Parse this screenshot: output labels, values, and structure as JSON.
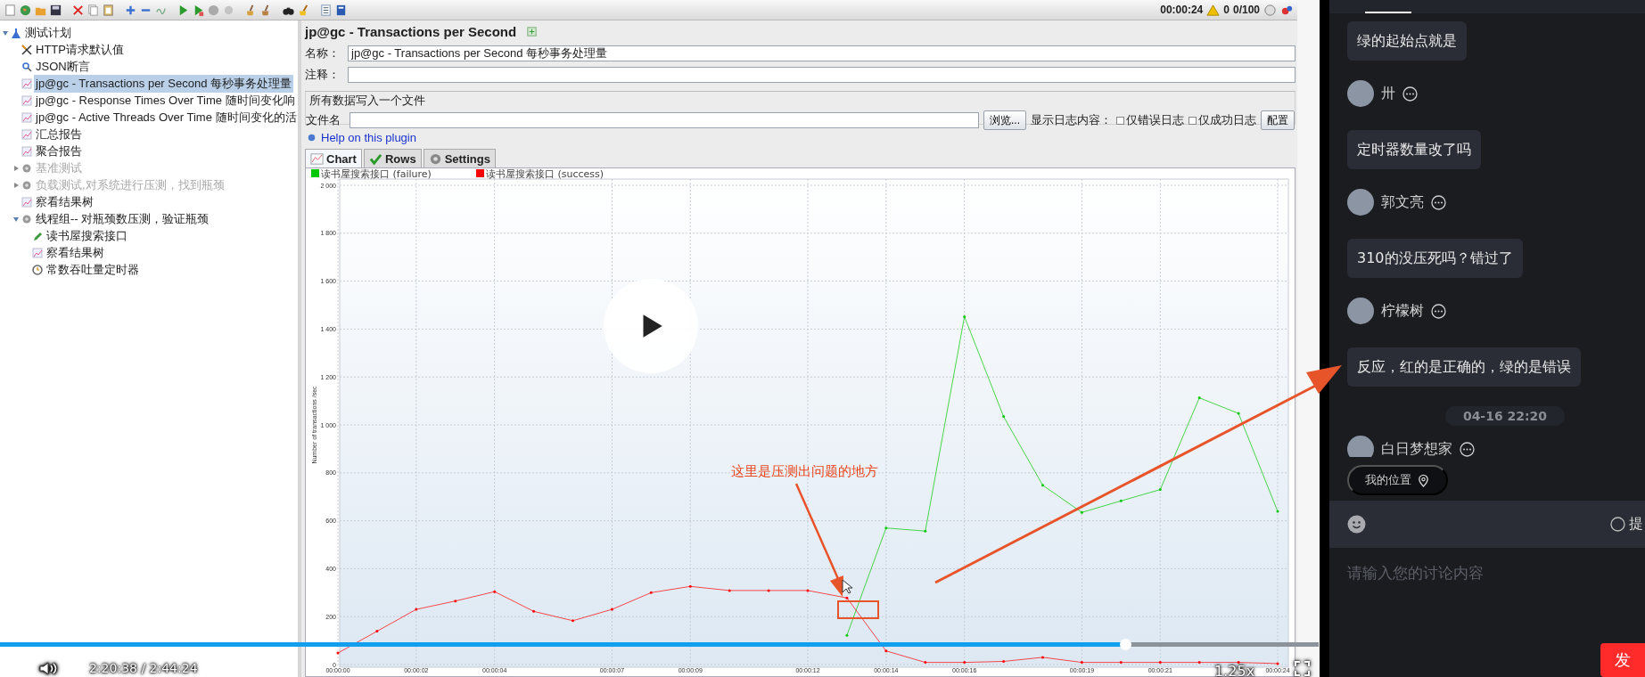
{
  "toolbar": {
    "elapsed": "00:00:24",
    "warnings": "0",
    "threads": "0/100"
  },
  "tree": {
    "label": "测试计划",
    "kind": "plan",
    "expanded": true,
    "selected": false,
    "disabled": false,
    "children": [
      {
        "label": "HTTP请求默认值",
        "kind": "config",
        "selected": false,
        "disabled": false
      },
      {
        "label": "JSON断言",
        "kind": "assertion",
        "selected": false,
        "disabled": false
      },
      {
        "label": "jp@gc - Transactions per Second 每秒事务处理量",
        "kind": "listener",
        "selected": true,
        "disabled": false
      },
      {
        "label": "jp@gc - Response Times Over Time 随时间变化响",
        "kind": "listener",
        "selected": false,
        "disabled": false
      },
      {
        "label": "jp@gc - Active Threads Over Time 随时间变化的活",
        "kind": "listener",
        "selected": false,
        "disabled": false
      },
      {
        "label": "汇总报告",
        "kind": "listener",
        "selected": false,
        "disabled": false
      },
      {
        "label": "聚合报告",
        "kind": "listener",
        "selected": false,
        "disabled": false
      },
      {
        "label": "基准测试",
        "kind": "thread_group",
        "expanded": false,
        "selected": false,
        "disabled": true
      },
      {
        "label": "负载测试,对系统进行压测，找到瓶颈",
        "kind": "thread_group",
        "expanded": false,
        "selected": false,
        "disabled": true
      },
      {
        "label": "察看结果树",
        "kind": "listener",
        "selected": false,
        "disabled": false
      },
      {
        "label": "线程组-- 对瓶颈数压测，验证瓶颈",
        "kind": "thread_group",
        "expanded": true,
        "selected": false,
        "disabled": false,
        "children": [
          {
            "label": "读书屋搜索接口",
            "kind": "sampler",
            "selected": false,
            "disabled": false
          },
          {
            "label": "察看结果树",
            "kind": "listener",
            "selected": false,
            "disabled": false
          },
          {
            "label": "常数吞吐量定时器",
            "kind": "timer",
            "selected": false,
            "disabled": false
          }
        ]
      }
    ]
  },
  "editor": {
    "title": "jp@gc - Transactions per Second",
    "name_label": "名称：",
    "name_value": "jp@gc - Transactions per Second 每秒事务处理量",
    "comment_label": "注释：",
    "file_group": "所有数据写入一个文件",
    "file_label": "文件名",
    "browse_button": "浏览...",
    "log_label": "显示日志内容：",
    "log_options": [
      {
        "label": "仅错误日志",
        "checked": false
      },
      {
        "label": "仅成功日志",
        "checked": false
      }
    ],
    "config_button": "配置",
    "help_link": "Help on this plugin",
    "tabs": [
      {
        "label": "Chart",
        "kind": "chart",
        "selected": true
      },
      {
        "label": "Rows",
        "kind": "rows",
        "selected": false
      },
      {
        "label": "Settings",
        "kind": "settings",
        "selected": false
      }
    ],
    "chart_data": {
      "type": "line",
      "legend": "top-left",
      "grid": true,
      "ylabel": "Number of transactions /sec",
      "x": [
        0,
        1,
        2,
        3,
        4,
        5,
        6,
        7,
        8,
        9,
        10,
        11,
        12,
        13,
        14,
        15,
        16,
        17,
        18,
        19,
        20,
        21,
        22,
        23,
        24
      ],
      "xlim": [
        0,
        24
      ],
      "ylim": [
        0,
        2000
      ],
      "series": [
        {
          "name": "读书屋搜索接口 (failure)",
          "color": "#00c800",
          "values": [
            null,
            null,
            null,
            null,
            null,
            null,
            null,
            null,
            null,
            null,
            null,
            null,
            null,
            122,
            570,
            557,
            1452,
            1035,
            748,
            635,
            683,
            730,
            1113,
            1048,
            639
          ]
        },
        {
          "name": "读书屋搜索接口 (success)",
          "color": "#ff0000",
          "values": [
            48,
            139,
            230,
            265,
            304,
            222,
            183,
            230,
            300,
            326,
            309,
            309,
            309,
            278,
            57,
            9,
            9,
            13,
            30,
            9,
            9,
            9,
            9,
            9,
            4
          ]
        }
      ],
      "xticks": [
        {
          "value": 0,
          "label": "00:00:00"
        },
        {
          "value": 2,
          "label": "00:00:02"
        },
        {
          "value": 4,
          "label": "00:00:04"
        },
        {
          "value": 7,
          "label": "00:00:07"
        },
        {
          "value": 9,
          "label": "00:00:09"
        },
        {
          "value": 12,
          "label": "00:00:12"
        },
        {
          "value": 14,
          "label": "00:00:14"
        },
        {
          "value": 16,
          "label": "00:00:16"
        },
        {
          "value": 19,
          "label": "00:00:19"
        },
        {
          "value": 21,
          "label": "00:00:21"
        },
        {
          "value": 24,
          "label": "00:00:24"
        }
      ],
      "yticks": [
        {
          "value": 0,
          "label": "0"
        },
        {
          "value": 200,
          "label": "200"
        },
        {
          "value": 400,
          "label": "400"
        },
        {
          "value": 600,
          "label": "600"
        },
        {
          "value": 800,
          "label": "800"
        },
        {
          "value": 1000,
          "label": "1 000"
        },
        {
          "value": 1200,
          "label": "1 200"
        },
        {
          "value": 1400,
          "label": "1 400"
        },
        {
          "value": 1600,
          "label": "1 600"
        },
        {
          "value": 1800,
          "label": "1 800"
        },
        {
          "value": 2000,
          "label": "2 000"
        }
      ]
    }
  },
  "video": {
    "progress": {
      "level": 0.853
    },
    "time": "2:20:38 / 2:44:24",
    "speed": "1.25x"
  },
  "annotation": {
    "callout": "这里是压测出问题的地方"
  },
  "chat": {
    "messages": [
      {
        "kind": "bubble",
        "text": "绿的起始点就是"
      },
      {
        "kind": "user",
        "name": "卅"
      },
      {
        "kind": "bubble",
        "text": "定时器数量改了吗"
      },
      {
        "kind": "user",
        "name": "郭文亮"
      },
      {
        "kind": "bubble",
        "text": "310的没压死吗？错过了"
      },
      {
        "kind": "user",
        "name": "柠檬树"
      },
      {
        "kind": "bubble",
        "text": "反应，红的是正确的，绿的是错误"
      },
      {
        "kind": "date",
        "text": "04-16 22:20"
      },
      {
        "kind": "user",
        "name": "白日梦想家"
      }
    ],
    "location": "我的位置",
    "question_checked": false,
    "question_option": "提",
    "placeholder": "请输入您的讨论内容",
    "send_button": "发"
  }
}
